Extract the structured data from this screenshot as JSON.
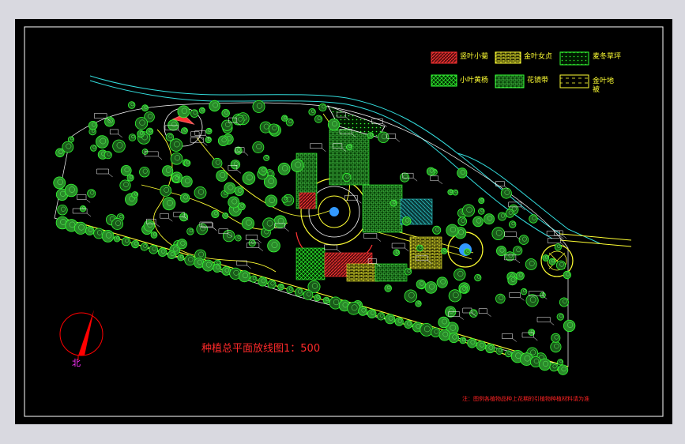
{
  "drawing": {
    "title": "种植总平面放线图1：500",
    "note": "注：图例各植物品种上花期的引植物种植材料请为准",
    "north_label": "北",
    "legend": [
      {
        "id": "a",
        "label": "竖叶小菊",
        "pattern": "diag-red"
      },
      {
        "id": "b",
        "label": "金叶女贞",
        "pattern": "brick-yellow"
      },
      {
        "id": "c",
        "label": "麦冬草坪",
        "pattern": "dots-green"
      },
      {
        "id": "d",
        "label": "小叶黄杨",
        "pattern": "cross-green"
      },
      {
        "id": "e",
        "label": "花镜带",
        "pattern": "grid-green"
      },
      {
        "id": "f",
        "label": "金叶地被",
        "pattern": "dash-yellow"
      }
    ],
    "colors": {
      "background": "#000000",
      "frame": "#d9d9e0",
      "border": "#ffffff",
      "trees": "#33ff33",
      "paths": "#ffff33",
      "water": "#33dddd",
      "labels": "#ffffff",
      "title": "#ff2a2a",
      "north_arrow": "#ff0000"
    }
  }
}
